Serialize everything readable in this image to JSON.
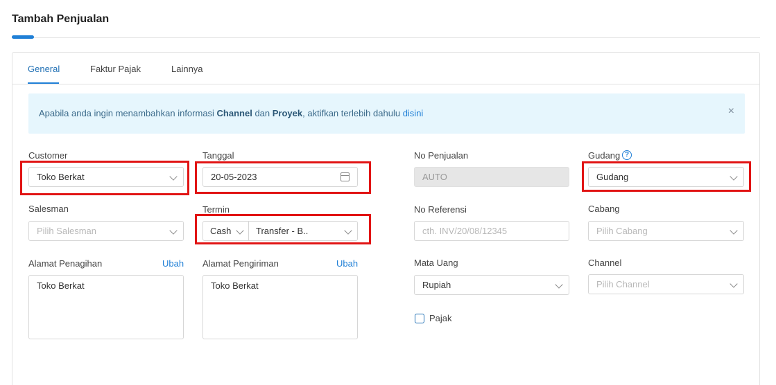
{
  "page": {
    "title": "Tambah Penjualan"
  },
  "tabs": [
    {
      "label": "General",
      "active": true
    },
    {
      "label": "Faktur Pajak",
      "active": false
    },
    {
      "label": "Lainnya",
      "active": false
    }
  ],
  "alert": {
    "text_1": "Apabila anda ingin menambahkan informasi ",
    "bold_1": "Channel",
    "text_2": " dan ",
    "bold_2": "Proyek",
    "text_3": ", aktifkan terlebih dahulu ",
    "link": "disini",
    "close": "×"
  },
  "form": {
    "customer": {
      "label": "Customer",
      "value": "Toko Berkat"
    },
    "tanggal": {
      "label": "Tanggal",
      "value": "20-05-2023"
    },
    "no_penjualan": {
      "label": "No Penjualan",
      "value": "AUTO"
    },
    "gudang": {
      "label": "Gudang",
      "value": "Gudang",
      "help": "?"
    },
    "salesman": {
      "label": "Salesman",
      "placeholder": "Pilih Salesman"
    },
    "termin": {
      "label": "Termin",
      "type_value": "Cash",
      "method_value": "Transfer - B.."
    },
    "no_referensi": {
      "label": "No Referensi",
      "placeholder": "cth. INV/20/08/12345"
    },
    "cabang": {
      "label": "Cabang",
      "placeholder": "Pilih Cabang"
    },
    "alamat_penagihan": {
      "label": "Alamat Penagihan",
      "action": "Ubah",
      "value": "Toko Berkat"
    },
    "alamat_pengiriman": {
      "label": "Alamat Pengiriman",
      "action": "Ubah",
      "value": "Toko Berkat"
    },
    "mata_uang": {
      "label": "Mata Uang",
      "value": "Rupiah"
    },
    "channel": {
      "label": "Channel",
      "placeholder": "Pilih Channel"
    },
    "pajak": {
      "label": "Pajak",
      "checked": false
    }
  },
  "colors": {
    "accent": "#1f7fd6",
    "alert_bg": "#e6f6fd",
    "highlight": "#e11414"
  }
}
